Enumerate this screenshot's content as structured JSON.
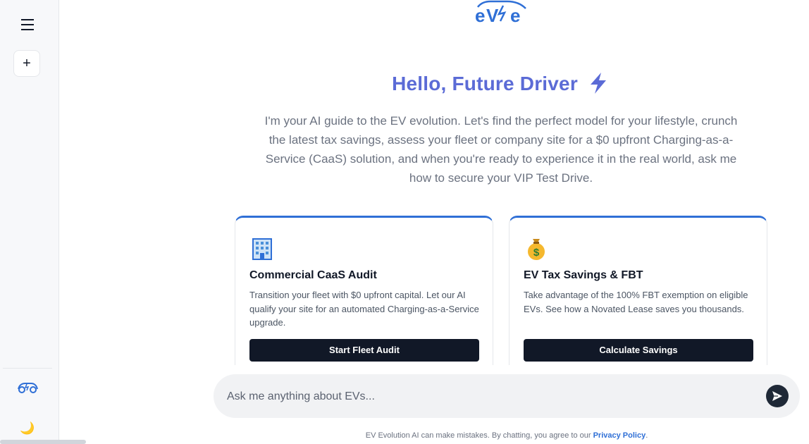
{
  "sidebar": {
    "menu_icon": "hamburger-menu-icon",
    "new_chat_symbol": "+",
    "logo_icon": "ev-car-logo-icon",
    "theme_toggle_symbol": "🌙"
  },
  "header": {
    "logo_text": "eV eV"
  },
  "hero": {
    "title": "Hello, Future Driver",
    "title_icon": "lightning-bolt-icon",
    "intro": "I'm your AI guide to the EV evolution. Let's find the perfect model for your lifestyle, crunch the latest tax savings, assess your fleet or company site for a $0 upfront Charging-as-a-Service (CaaS) solution, and when you're ready to experience it in the real world, ask me how to secure your VIP Test Drive."
  },
  "cards": [
    {
      "icon": "office-building-icon",
      "title": "Commercial CaaS Audit",
      "description": "Transition your fleet with $0 upfront capital. Let our AI qualify your site for an automated Charging-as-a-Service upgrade.",
      "button": "Start Fleet Audit"
    },
    {
      "icon": "money-bag-icon",
      "title": "EV Tax Savings & FBT",
      "description": "Take advantage of the 100% FBT exemption on eligible EVs. See how a Novated Lease saves you thousands.",
      "button": "Calculate Savings"
    }
  ],
  "chat": {
    "placeholder": "Ask me anything about EVs...",
    "send_icon": "send-arrow-icon"
  },
  "footer": {
    "disclaimer": "EV Evolution AI can make mistakes. By chatting, you agree to our",
    "privacy_link": "Privacy Policy",
    "end": "."
  },
  "colors": {
    "accent": "#2f6fd6",
    "title": "#5b6bd6",
    "button": "#111827"
  }
}
